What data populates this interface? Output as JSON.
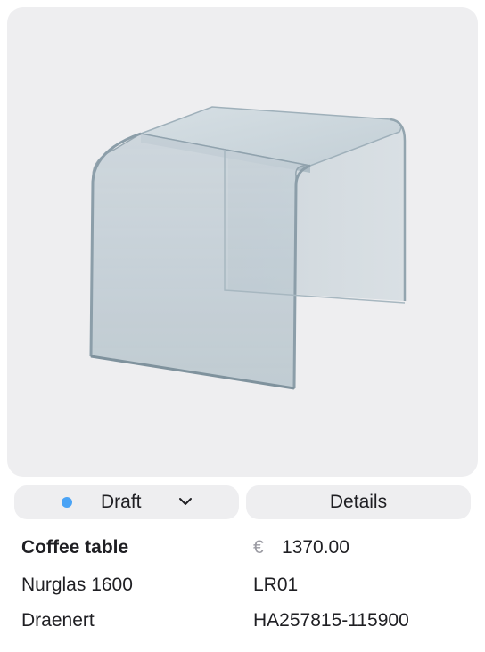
{
  "product": {
    "name": "Coffee table",
    "model": "Nurglas 1600",
    "brand": "Draenert",
    "currency_symbol": "€",
    "price": "1370.00",
    "room_code": "LR01",
    "article_number": "HA257815-115900"
  },
  "status": {
    "label": "Draft",
    "dot_color": "#4aa3f5",
    "dropdown_icon": "chevron-down-icon"
  },
  "actions": {
    "details_label": "Details"
  },
  "image": {
    "subject": "glass side table",
    "background_color": "#eeeef0"
  }
}
